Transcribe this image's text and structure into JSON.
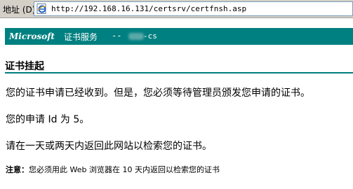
{
  "address_bar": {
    "label": "地址 (D)",
    "url": "http://192.168.16.131/certsrv/certfnsh.asp"
  },
  "banner": {
    "brand": "Microsoft",
    "service": "证书服务",
    "separator": "--",
    "ca_suffix": "-cs"
  },
  "main": {
    "title": "证书挂起",
    "paragraph1": "您的证书申请已经收到。但是，您必须等待管理员颁发您申请的证书。",
    "paragraph2": "您的申请 Id 为 5。",
    "paragraph3": "请在一天或两天内返回此网站以检索您的证书。",
    "note_label": "注意：",
    "note_text": "您必须用此 Web 浏览器在 10 天内返回以检索您的证书"
  },
  "colors": {
    "banner_bg": "#008080",
    "banner_text": "#ffffff",
    "rule": "#008080"
  },
  "icons": [
    "ie-page-icon"
  ]
}
